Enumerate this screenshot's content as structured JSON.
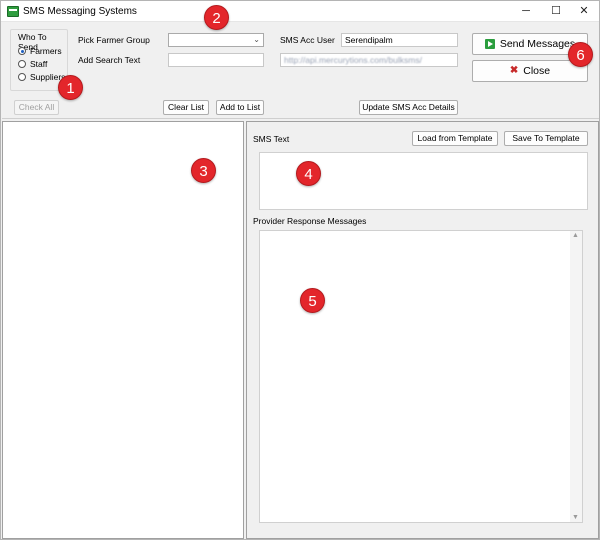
{
  "window": {
    "title": "SMS Messaging Systems",
    "controls": {
      "minimize": "─",
      "maximize": "☐",
      "close": "✕"
    }
  },
  "who_to_send": {
    "title": "Who To Send",
    "options": [
      {
        "label": "Farmers",
        "selected": true
      },
      {
        "label": "Staff",
        "selected": false
      },
      {
        "label": "Suppliers",
        "selected": false
      }
    ]
  },
  "form": {
    "pick_farmer_group_label": "Pick Farmer Group",
    "pick_farmer_group_value": "",
    "add_search_text_label": "Add Search Text",
    "add_search_text_value": "",
    "sms_acc_user_label": "SMS Acc User",
    "sms_acc_user_value": "Serendipalm",
    "api_url_value": "http://api.mercurytions.com/bulksms/"
  },
  "buttons": {
    "check_all": "Check All",
    "clear_list": "Clear List",
    "add_to_list": "Add to List",
    "update_sms_acc": "Update SMS Acc Details",
    "send_messages": "Send Messages",
    "close": "Close",
    "load_template": "Load from Template",
    "save_template": "Save To Template"
  },
  "sms_text": {
    "label": "SMS Text",
    "value": ""
  },
  "provider_response": {
    "label": "Provider Response Messages",
    "value": ""
  },
  "annotations": [
    "1",
    "2",
    "3",
    "4",
    "5",
    "6"
  ],
  "colors": {
    "annotation_red": "#e3262b",
    "send_icon_green": "#2a9d3d",
    "app_icon_green": "#2e9d3e"
  }
}
